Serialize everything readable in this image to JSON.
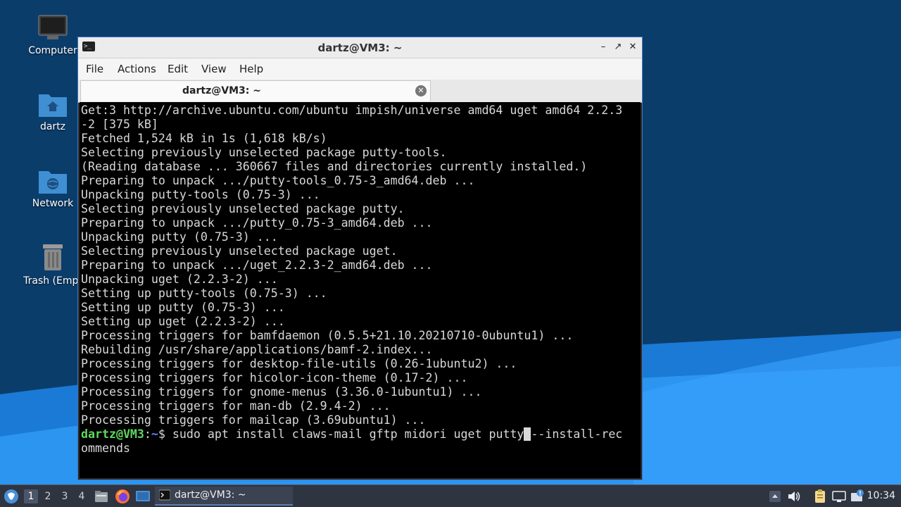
{
  "desktop": {
    "icons": [
      {
        "label": "Computer"
      },
      {
        "label": "dartz"
      },
      {
        "label": "Network"
      },
      {
        "label": "Trash (Empt"
      }
    ]
  },
  "window": {
    "title": "dartz@VM3: ~",
    "menu": [
      "File",
      "Actions",
      "Edit",
      "View",
      "Help"
    ],
    "tab_label": "dartz@VM3: ~"
  },
  "terminal": {
    "lines": [
      "Get:3 http://archive.ubuntu.com/ubuntu impish/universe amd64 uget amd64 2.2.3",
      "-2 [375 kB]",
      "Fetched 1,524 kB in 1s (1,618 kB/s)",
      "Selecting previously unselected package putty-tools.",
      "(Reading database ... 360667 files and directories currently installed.)",
      "Preparing to unpack .../putty-tools_0.75-3_amd64.deb ...",
      "Unpacking putty-tools (0.75-3) ...",
      "Selecting previously unselected package putty.",
      "Preparing to unpack .../putty_0.75-3_amd64.deb ...",
      "Unpacking putty (0.75-3) ...",
      "Selecting previously unselected package uget.",
      "Preparing to unpack .../uget_2.2.3-2_amd64.deb ...",
      "Unpacking uget (2.2.3-2) ...",
      "Setting up putty-tools (0.75-3) ...",
      "Setting up putty (0.75-3) ...",
      "Setting up uget (2.2.3-2) ...",
      "Processing triggers for bamfdaemon (0.5.5+21.10.20210710-0ubuntu1) ...",
      "Rebuilding /usr/share/applications/bamf-2.index...",
      "Processing triggers for desktop-file-utils (0.26-1ubuntu2) ...",
      "Processing triggers for hicolor-icon-theme (0.17-2) ...",
      "Processing triggers for gnome-menus (3.36.0-1ubuntu1) ...",
      "Processing triggers for man-db (2.9.4-2) ...",
      "Processing triggers for mailcap (3.69ubuntu1) ..."
    ],
    "prompt_user": "dartz@VM3",
    "prompt_sep": ":",
    "prompt_path": "~",
    "prompt_dollar": "$ ",
    "command_before_cursor": "sudo apt install claws-mail gftp midori uget putty",
    "cursor_char": " ",
    "command_after_cursor": "--install-rec",
    "command_wrap": "ommends"
  },
  "taskbar": {
    "workspaces": [
      "1",
      "2",
      "3",
      "4"
    ],
    "task_label": "dartz@VM3: ~",
    "clock": "10:34"
  }
}
